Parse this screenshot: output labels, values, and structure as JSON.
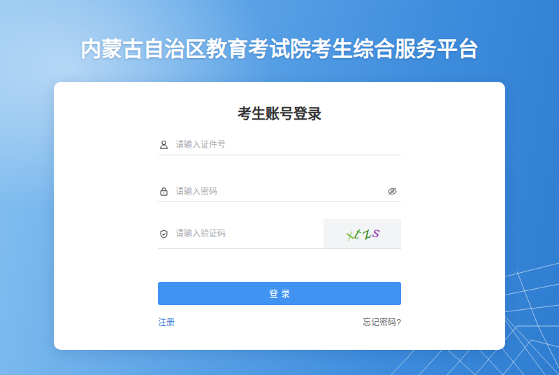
{
  "page": {
    "title": "内蒙古自治区教育考试院考生综合服务平台"
  },
  "login": {
    "heading": "考生账号登录",
    "fields": [
      {
        "kind": "text",
        "placeholder": "请输入证件号"
      },
      {
        "kind": "password",
        "placeholder": "请输入密码",
        "revealed": false
      },
      {
        "kind": "captcha",
        "placeholder": "请输入验证码"
      }
    ],
    "captcha": [
      {
        "char": "x",
        "color": "#7cc043"
      },
      {
        "char": "t",
        "color": "#4f9f2f"
      },
      {
        "char": "z",
        "color": "#3e8a2c"
      },
      {
        "char": "s",
        "color": "#9a3fb0"
      }
    ],
    "submit": "登 录",
    "links": [
      {
        "label": "注册"
      },
      {
        "label": "忘记密码?"
      }
    ]
  }
}
